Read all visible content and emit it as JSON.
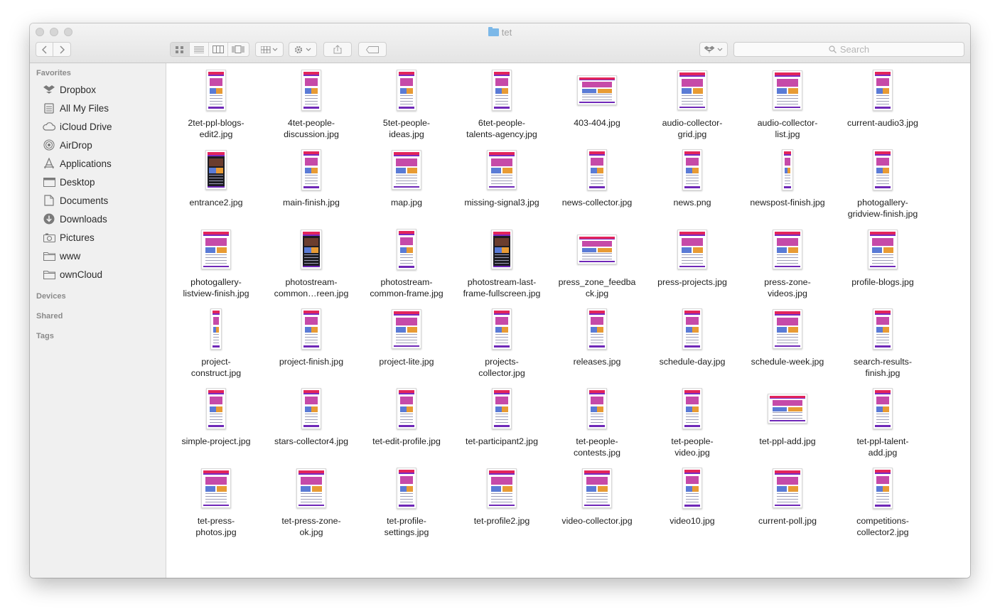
{
  "window": {
    "title": "tet"
  },
  "toolbar": {
    "back_icon": "chevron-left-icon",
    "forward_icon": "chevron-right-icon",
    "views": [
      {
        "name": "icon-view",
        "icon": "grid-icon",
        "active": true
      },
      {
        "name": "list-view",
        "icon": "list-icon",
        "active": false
      },
      {
        "name": "column-view",
        "icon": "columns-icon",
        "active": false
      },
      {
        "name": "coverflow-view",
        "icon": "coverflow-icon",
        "active": false
      }
    ],
    "search_placeholder": "Search"
  },
  "sidebar": {
    "favorites_label": "Favorites",
    "favorites": [
      {
        "label": "Dropbox",
        "icon": "dropbox-icon"
      },
      {
        "label": "All My Files",
        "icon": "all-files-icon"
      },
      {
        "label": "iCloud Drive",
        "icon": "cloud-icon"
      },
      {
        "label": "AirDrop",
        "icon": "airdrop-icon"
      },
      {
        "label": "Applications",
        "icon": "applications-icon"
      },
      {
        "label": "Desktop",
        "icon": "desktop-icon"
      },
      {
        "label": "Documents",
        "icon": "documents-icon"
      },
      {
        "label": "Downloads",
        "icon": "downloads-icon"
      },
      {
        "label": "Pictures",
        "icon": "pictures-icon"
      },
      {
        "label": "www",
        "icon": "folder-icon"
      },
      {
        "label": "ownCloud",
        "icon": "folder-icon"
      }
    ],
    "devices_label": "Devices",
    "shared_label": "Shared",
    "tags_label": "Tags"
  },
  "files": [
    {
      "l1": "2tet-ppl-blogs-",
      "l2": "edit2.jpg",
      "shape": "tall"
    },
    {
      "l1": "4tet-people-",
      "l2": "discussion.jpg",
      "shape": "tall"
    },
    {
      "l1": "5tet-people-",
      "l2": "ideas.jpg",
      "shape": "tall"
    },
    {
      "l1": "6tet-people-",
      "l2": "talents-agency.jpg",
      "shape": "tall"
    },
    {
      "l1": "403-404.jpg",
      "l2": "",
      "shape": "wide"
    },
    {
      "l1": "audio-collector-",
      "l2": "grid.jpg",
      "shape": "medium"
    },
    {
      "l1": "audio-collector-",
      "l2": "list.jpg",
      "shape": "medium"
    },
    {
      "l1": "current-audio3.jpg",
      "l2": "",
      "shape": "tall"
    },
    {
      "l1": "entrance2.jpg",
      "l2": "",
      "shape": "dark"
    },
    {
      "l1": "main-finish.jpg",
      "l2": "",
      "shape": "tall"
    },
    {
      "l1": "map.jpg",
      "l2": "",
      "shape": "medium"
    },
    {
      "l1": "missing-signal3.jpg",
      "l2": "",
      "shape": "medium"
    },
    {
      "l1": "news-collector.jpg",
      "l2": "",
      "shape": "tall"
    },
    {
      "l1": "news.png",
      "l2": "",
      "shape": "tall"
    },
    {
      "l1": "newspost-finish.jpg",
      "l2": "",
      "shape": "narrow"
    },
    {
      "l1": "photogallery-",
      "l2": "gridview-finish.jpg",
      "shape": "tall"
    },
    {
      "l1": "photogallery-",
      "l2": "listview-finish.jpg",
      "shape": "medium"
    },
    {
      "l1": "photostream-",
      "l2": "common…reen.jpg",
      "shape": "dark"
    },
    {
      "l1": "photostream-",
      "l2": "common-frame.jpg",
      "shape": "tall"
    },
    {
      "l1": "photostream-last-",
      "l2": "frame-fullscreen.jpg",
      "shape": "dark"
    },
    {
      "l1": "press_zone_feedba",
      "l2": "ck.jpg",
      "shape": "wide"
    },
    {
      "l1": "press-projects.jpg",
      "l2": "",
      "shape": "medium"
    },
    {
      "l1": "press-zone-",
      "l2": "videos.jpg",
      "shape": "medium"
    },
    {
      "l1": "profile-blogs.jpg",
      "l2": "",
      "shape": "medium"
    },
    {
      "l1": "project-",
      "l2": "construct.jpg",
      "shape": "narrow"
    },
    {
      "l1": "project-finish.jpg",
      "l2": "",
      "shape": "tall"
    },
    {
      "l1": "project-lite.jpg",
      "l2": "",
      "shape": "medium"
    },
    {
      "l1": "projects-",
      "l2": "collector.jpg",
      "shape": "tall"
    },
    {
      "l1": "releases.jpg",
      "l2": "",
      "shape": "tall"
    },
    {
      "l1": "schedule-day.jpg",
      "l2": "",
      "shape": "tall"
    },
    {
      "l1": "schedule-week.jpg",
      "l2": "",
      "shape": "medium"
    },
    {
      "l1": "search-results-",
      "l2": "finish.jpg",
      "shape": "tall"
    },
    {
      "l1": "simple-project.jpg",
      "l2": "",
      "shape": "tall"
    },
    {
      "l1": "stars-collector4.jpg",
      "l2": "",
      "shape": "tall"
    },
    {
      "l1": "tet-edit-profile.jpg",
      "l2": "",
      "shape": "tall"
    },
    {
      "l1": "tet-participant2.jpg",
      "l2": "",
      "shape": "tall"
    },
    {
      "l1": "tet-people-",
      "l2": "contests.jpg",
      "shape": "tall"
    },
    {
      "l1": "tet-people-",
      "l2": "video.jpg",
      "shape": "tall"
    },
    {
      "l1": "tet-ppl-add.jpg",
      "l2": "",
      "shape": "wide"
    },
    {
      "l1": "tet-ppl-talent-",
      "l2": "add.jpg",
      "shape": "tall"
    },
    {
      "l1": "tet-press-",
      "l2": "photos.jpg",
      "shape": "medium"
    },
    {
      "l1": "tet-press-zone-",
      "l2": "ok.jpg",
      "shape": "medium"
    },
    {
      "l1": "tet-profile-",
      "l2": "settings.jpg",
      "shape": "tall"
    },
    {
      "l1": "tet-profile2.jpg",
      "l2": "",
      "shape": "medium"
    },
    {
      "l1": "video-collector.jpg",
      "l2": "",
      "shape": "medium"
    },
    {
      "l1": "video10.jpg",
      "l2": "",
      "shape": "tall"
    },
    {
      "l1": "current-poll.jpg",
      "l2": "",
      "shape": "medium"
    },
    {
      "l1": "competitions-",
      "l2": "collector2.jpg",
      "shape": "tall"
    }
  ]
}
